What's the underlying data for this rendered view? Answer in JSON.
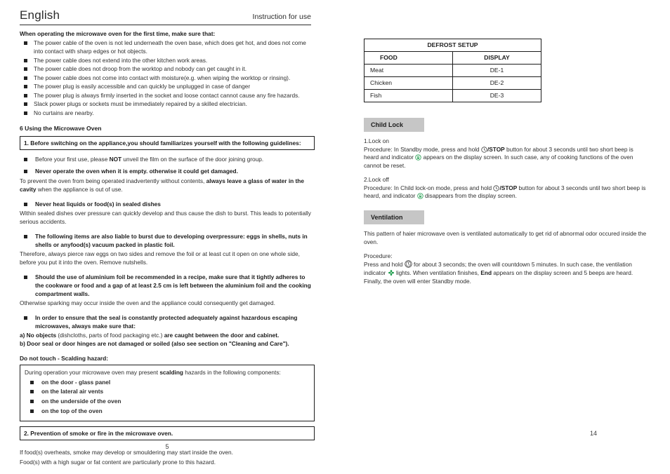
{
  "header": {
    "language": "English",
    "note": "Instruction for use"
  },
  "left": {
    "first_time_heading": "When operating the microwave oven for the first time, make sure that:",
    "first_time_items": [
      "The power cable of the oven is not led underneath the oven base, which does get hot, and does not come into contact with  sharp edges or hot objects.",
      "The power cable  does not extend into the other  kitchen work areas.",
      "The power cable does  not droop from the worktop  and nobody can get caught in it.",
      "The power cable does not come into contact with moisture(e.g. when wiping the worktop or rinsing).",
      "The power plug  is easily accessible and can quickly  be unplugged in case  of danger",
      "The power plug is always firmly inserted in the socket and loose contact  cannot cause any fire hazards.",
      "Slack power plugs  or sockets must be immediately  repaired by a skilled  electrician.",
      "No curtains are  nearby."
    ],
    "section_title": "6 Using the Microwave Oven",
    "box1": "1. Before switching on the  appliance,you should familiarizes yourself with  the following guidelines:",
    "film_bullet_a": "Before your first use, please ",
    "film_bullet_b": "NOT",
    "film_bullet_c": " unveil the film on the surface of the door joining group.",
    "never_empty": "Never operate the oven when it is empty. otherwise it could get damaged.",
    "never_empty_body_a": "To prevent the oven from being  operated inadvertently without contents, ",
    "never_empty_body_b": "always leave a glass of water in the cavity",
    "never_empty_body_c": " when the appliance is out of use.",
    "sealed_heading": "Never heat liquids or food(s) in sealed dishes",
    "sealed_body": "Within sealed dishes over pressure can quickly develop and thus cause the dish to burst. This leads to potentially serious accidents.",
    "burst_heading": "The following items are also liable to burst due to developing overpressure: eggs in shells, nuts in shells or anyfood(s) vacuum packed in plastic foil.",
    "burst_body": "Therefore, always pierce raw eggs on two sides and remove the foil or at least cut it  open on one whole side, before you  put it into the oven.  Remove nutshells.",
    "foil_heading": "Should the use of aluminium  foil be recommended in a  recipe, make sure that it  tightly adheres to the cookware or  food and  a gap of  at least 2.5 cm is left between  the aluminium foil  and the cooking compartment walls.",
    "foil_body": "Otherwise sparking may occur inside the oven and the appliance could consequently get damaged.",
    "seal_heading": "In order to ensure that the seal is constantly protected adequately against hazardous escaping microwaves,  always make sure that:",
    "seal_a_bold1": "a)  No objects",
    "seal_a_normal": " (dishcloths, parts of food  packaging etc.) ",
    "seal_a_bold2": "are caught between the door and cabinet.",
    "seal_b": "b)  Door seal or door hinges are not damaged or  soiled (also see section on \"Cleaning  and Care\").",
    "scald_heading": "Do not touch - Scalding hazard:",
    "scald_intro_a": "During operation your microwave oven may present ",
    "scald_intro_b": "scalding",
    "scald_intro_c": " hazards in the following components:",
    "scald_items": [
      "on the door - glass panel",
      "on the lateral air vents",
      "on the underside of the oven",
      "on the top of the oven"
    ],
    "box2": "2. Prevention of smoke or fire in the microwave oven.",
    "smoke_line1": "If food(s) overheats, smoke may develop or smouldering may start inside the oven.",
    "smoke_line2": "Food(s) with a high sugar or fat content are particularly prone to this hazard.",
    "page_number": "5"
  },
  "right": {
    "table": {
      "title": "DEFROST SETUP",
      "columns": [
        "FOOD",
        "DISPLAY"
      ],
      "rows": [
        [
          "Meat",
          "DE-1"
        ],
        [
          "Chicken",
          "DE-2"
        ],
        [
          "Fish",
          "DE-3"
        ]
      ]
    },
    "child_lock": {
      "band": "Child Lock",
      "lock_on_title": "1.Lock on",
      "lock_on_a": "Procedure: In Standby mode, press and hold  ",
      "lock_on_stop": "/STOP",
      "lock_on_b": " button for about 3 seconds until two short beep is heard and indicator ",
      "lock_on_c": " appears on the display screen. In such case, any of cooking functions of the oven cannot be reset.",
      "lock_off_title": "2.Lock off",
      "lock_off_a": "Procedure: In Child lock-on mode, press and hold  ",
      "lock_off_stop": "/STOP",
      "lock_off_b": " button for about 3 seconds until two short beep is heard, and indicator ",
      "lock_off_c": " disappears from the display screen."
    },
    "ventilation": {
      "band": "Ventilation",
      "intro": "This pattern of haier microwave oven is ventilated automatically to get rid of abnormal odor occured inside the oven.",
      "procedure_title": "Procedure:",
      "proc_a": "Press and hold  ",
      "proc_b": "  for about 3 seconds; the oven will countdown 5 minutes. In such case, the ventilation indicator ",
      "proc_c": "  lights. When ventilation finishes, ",
      "proc_end": "End",
      "proc_d": " appears on the display screen and 5 beeps are heard. Finally, the oven will enter Standby mode."
    },
    "page_number": "14"
  },
  "icons": {
    "stop_button": "stop-clock-icon",
    "child_lock_indicator": "child-lock-indicator-icon",
    "clock_button": "clock-button-icon",
    "fan_indicator": "fan-indicator-icon"
  },
  "colors": {
    "band_background": "#c6c6c6",
    "indicator_green": "#1f9d4d",
    "text": "#2e2e2e",
    "rule": "#2b2b2b"
  }
}
